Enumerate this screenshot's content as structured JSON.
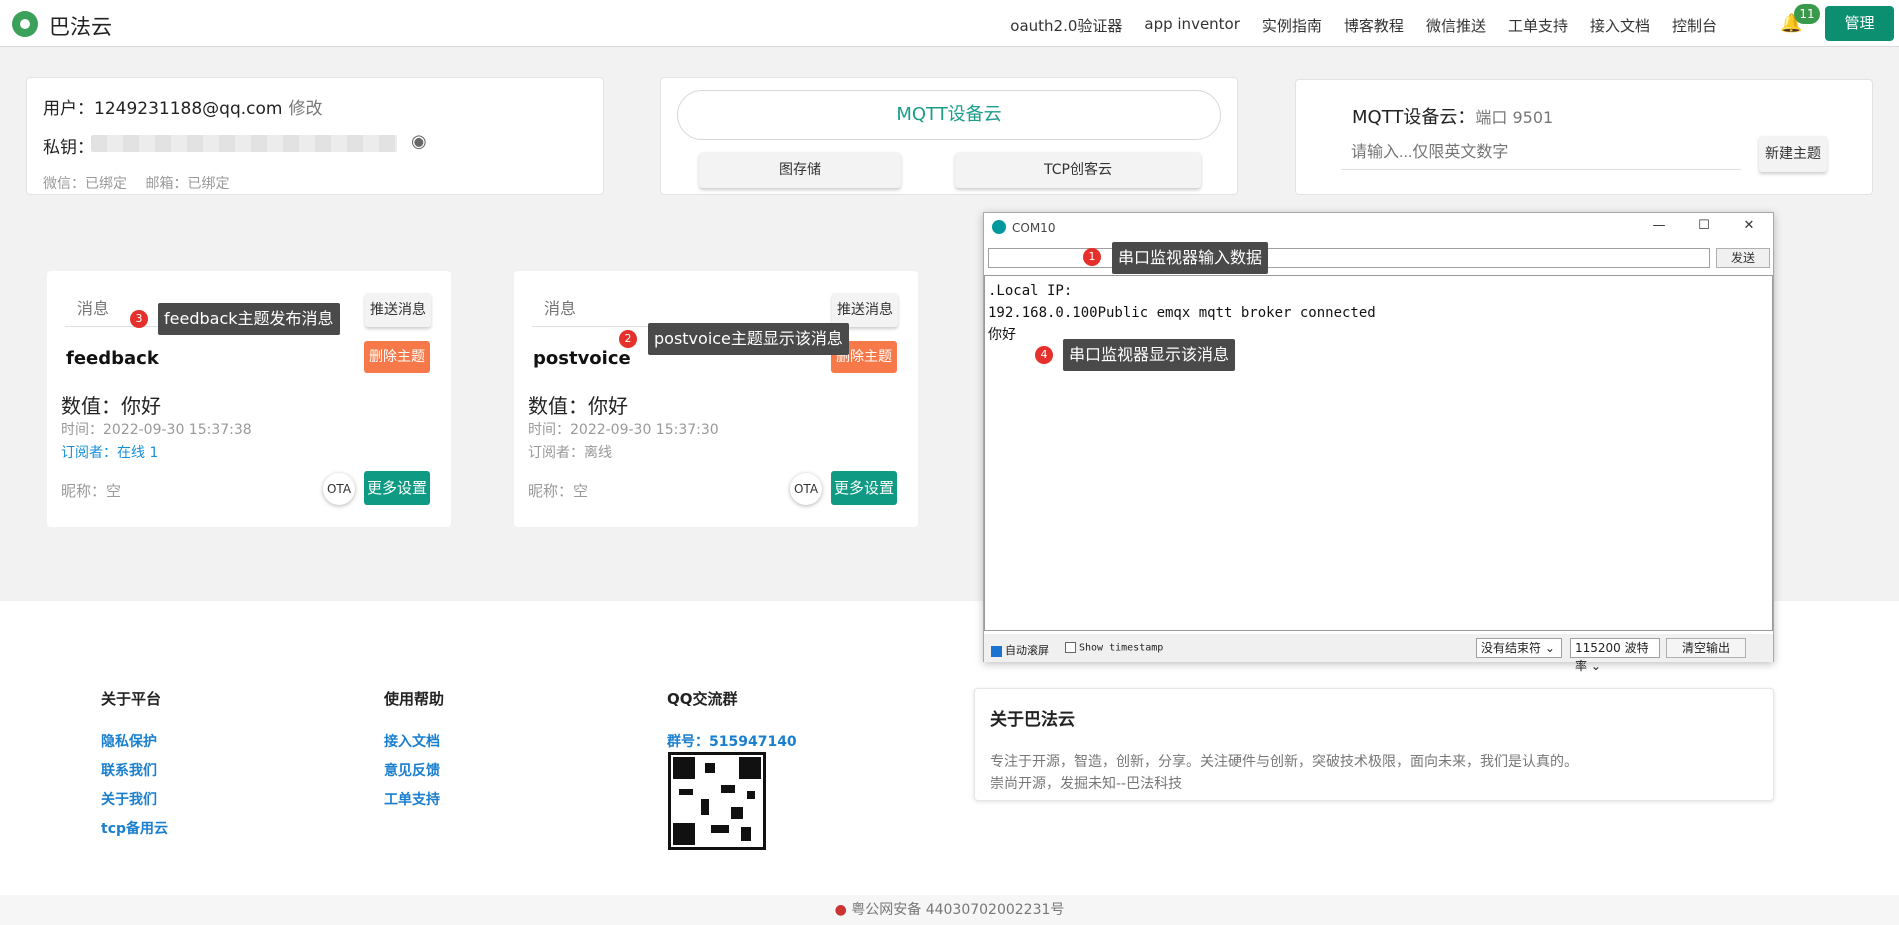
{
  "app": {
    "name": "巴法云"
  },
  "nav": {
    "items": [
      "oauth2.0验证器",
      "app inventor",
      "实例指南",
      "博客教程",
      "微信推送",
      "工单支持",
      "接入文档",
      "控制台"
    ],
    "badge": "11",
    "manage": "管理"
  },
  "account": {
    "user_label": "用户：",
    "user": "1249231188@qq.com",
    "edit": "修改",
    "key_label": "私钥：",
    "bind": "微信：已绑定　 邮箱：已绑定"
  },
  "center": {
    "mqtt": "MQTT设备云",
    "storage": "图存储",
    "tcp": "TCP创客云"
  },
  "topic_create": {
    "label": "MQTT设备云：",
    "port": "端口 9501",
    "placeholder": "请输入...仅限英文数字",
    "button": "新建主题"
  },
  "topics": [
    {
      "msg_placeholder": "消息",
      "push": "推送消息",
      "name": "feedback",
      "delete": "删除主题",
      "value": "数值：你好",
      "time": "时间：2022-09-30 15:37:38",
      "subs": "订阅者：在线 1",
      "nick": "昵称：空",
      "ota": "OTA",
      "more": "更多设置"
    },
    {
      "msg_placeholder": "消息",
      "push": "推送消息",
      "name": "postvoice",
      "delete": "删除主题",
      "value": "数值：你好",
      "time": "时间：2022-09-30 15:37:30",
      "subs": "订阅者：离线",
      "nick": "昵称：空",
      "ota": "OTA",
      "more": "更多设置"
    }
  ],
  "serial": {
    "title": "COM10",
    "send": "发送",
    "lines": [
      ".Local IP:",
      "192.168.0.100Public emqx mqtt broker connected",
      "你好"
    ],
    "autoscroll": "自动滚屏",
    "timestamp": "Show timestamp",
    "line_ending": "没有结束符",
    "baud": "115200 波特率",
    "clear": "清空输出"
  },
  "annotations": [
    {
      "num": "1",
      "text": "串口监视器输入数据"
    },
    {
      "num": "2",
      "text": "postvoice主题显示该消息"
    },
    {
      "num": "3",
      "text": "feedback主题发布消息"
    },
    {
      "num": "4",
      "text": "串口监视器显示该消息"
    }
  ],
  "footer": {
    "col1": {
      "title": "关于平台",
      "links": [
        "隐私保护",
        "联系我们",
        "关于我们",
        "tcp备用云"
      ]
    },
    "col2": {
      "title": "使用帮助",
      "links": [
        "接入文档",
        "意见反馈",
        "工单支持"
      ]
    },
    "col3": {
      "title": "QQ交流群",
      "group": "群号：515947140"
    },
    "about": {
      "title": "关于巴法云",
      "p1": "专注于开源，智造，创新，分享。关注硬件与创新，突破技术极限，面向未来，我们是认真的。",
      "p2": "崇尚开源，发掘未知--巴法科技"
    },
    "icp": "粤公网安备 44030702002231号"
  }
}
